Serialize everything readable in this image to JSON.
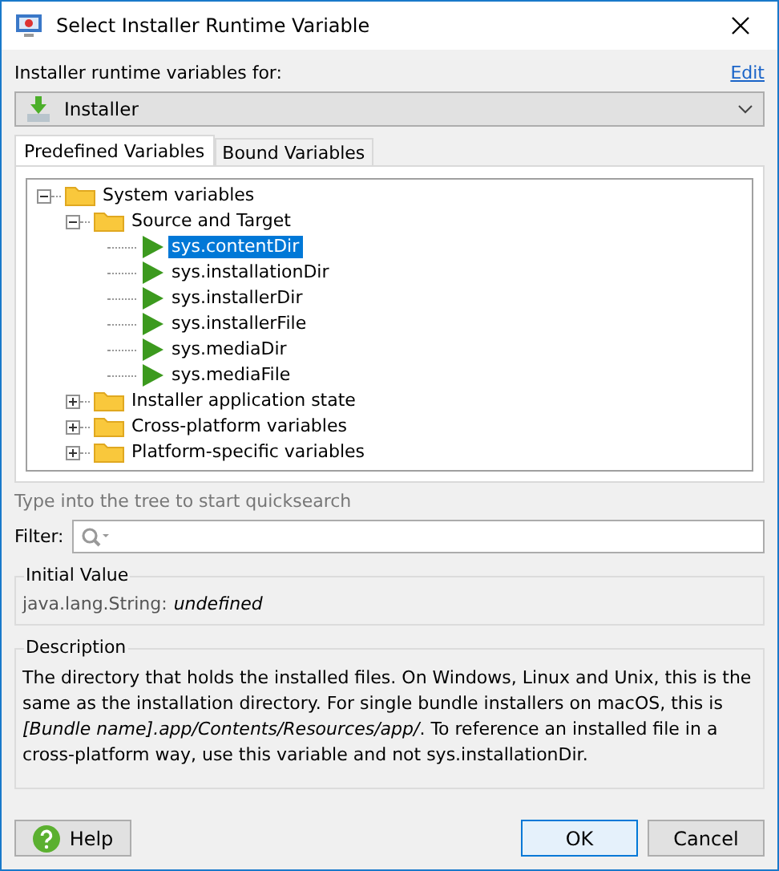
{
  "window": {
    "title": "Select Installer Runtime Variable"
  },
  "scope": {
    "label": "Installer runtime variables for:",
    "edit_link": "Edit",
    "combo_value": "Installer"
  },
  "tabs": [
    {
      "label": "Predefined Variables",
      "selected": true
    },
    {
      "label": "Bound Variables",
      "selected": false
    }
  ],
  "tree": [
    {
      "label": "System variables",
      "kind": "folder",
      "expanded": true,
      "children": [
        {
          "label": "Source and Target",
          "kind": "folder",
          "expanded": true,
          "children": [
            {
              "label": "sys.contentDir",
              "kind": "variable",
              "selected": true
            },
            {
              "label": "sys.installationDir",
              "kind": "variable",
              "selected": false
            },
            {
              "label": "sys.installerDir",
              "kind": "variable",
              "selected": false
            },
            {
              "label": "sys.installerFile",
              "kind": "variable",
              "selected": false
            },
            {
              "label": "sys.mediaDir",
              "kind": "variable",
              "selected": false
            },
            {
              "label": "sys.mediaFile",
              "kind": "variable",
              "selected": false
            }
          ]
        },
        {
          "label": "Installer application state",
          "kind": "folder",
          "expanded": false
        },
        {
          "label": "Cross-platform variables",
          "kind": "folder",
          "expanded": false
        },
        {
          "label": "Platform-specific variables",
          "kind": "folder",
          "expanded": false
        }
      ]
    }
  ],
  "quicksearch_hint": "Type into the tree to start quicksearch",
  "filter": {
    "label": "Filter:"
  },
  "initial_value": {
    "title": "Initial Value",
    "type": "java.lang.String:",
    "value": "undefined"
  },
  "description": {
    "title": "Description",
    "text": "The directory that holds the installed files. On Windows, Linux and Unix, this is the same as the installation directory. For single bundle installers on macOS, this is *[Bundle name].app/Contents/Resources/app/*. To reference an installed file in a cross-platform way, use this variable and not sys.installationDir."
  },
  "buttons": [
    {
      "label": "Help",
      "kind": "help"
    },
    {
      "label": "OK",
      "kind": "default"
    },
    {
      "label": "Cancel",
      "kind": "plain"
    }
  ]
}
